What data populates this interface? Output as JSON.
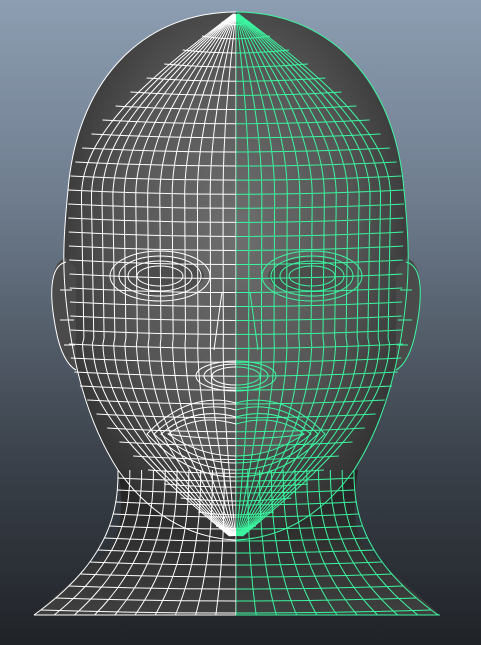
{
  "viewport": {
    "background_top": "#8d9eb2",
    "background_bottom": "#202328"
  },
  "model": {
    "object": "human-head-mesh",
    "display_mode": "wireframe-on-shaded",
    "shading_color": "#5a5a5a",
    "wire_unselected": "#ffffff",
    "wire_selected": "#3cf5a0",
    "selected_side": "right"
  }
}
